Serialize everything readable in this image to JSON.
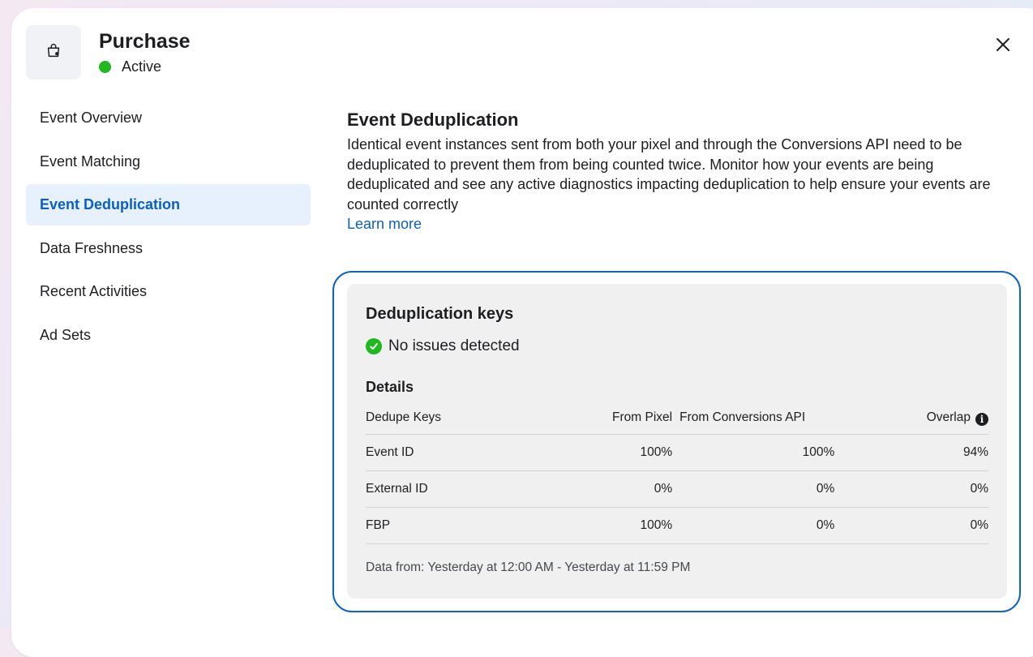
{
  "header": {
    "title": "Purchase",
    "status": "Active",
    "icon": "shopping-bag-icon",
    "status_color": "#1fb81f"
  },
  "sidebar": {
    "items": [
      {
        "label": "Event Overview",
        "active": false
      },
      {
        "label": "Event Matching",
        "active": false
      },
      {
        "label": "Event Deduplication",
        "active": true
      },
      {
        "label": "Data Freshness",
        "active": false
      },
      {
        "label": "Recent Activities",
        "active": false
      },
      {
        "label": "Ad Sets",
        "active": false
      }
    ]
  },
  "main": {
    "title": "Event Deduplication",
    "description": "Identical event instances sent from both your pixel and through the Conversions API need to be deduplicated to prevent them from being counted twice. Monitor how your events are being deduplicated and see any active diagnostics impacting deduplication to help ensure your events are counted correctly",
    "learn_more": "Learn more"
  },
  "card": {
    "title": "Deduplication keys",
    "status": "No issues detected",
    "details_title": "Details",
    "columns": [
      "Dedupe Keys",
      "From Pixel",
      "From Conversions API",
      "Overlap"
    ],
    "rows": [
      {
        "key": "Event ID",
        "pixel": "100%",
        "capi": "100%",
        "overlap": "94%"
      },
      {
        "key": "External ID",
        "pixel": "0%",
        "capi": "0%",
        "overlap": "0%"
      },
      {
        "key": "FBP",
        "pixel": "100%",
        "capi": "0%",
        "overlap": "0%"
      }
    ],
    "footnote": "Data from: Yesterday at 12:00 AM - Yesterday at 11:59 PM"
  },
  "colors": {
    "accent": "#0a5fc4",
    "active_bg": "#e7f0fd",
    "highlight_border": "#0b64c9",
    "success": "#1fb81f"
  }
}
